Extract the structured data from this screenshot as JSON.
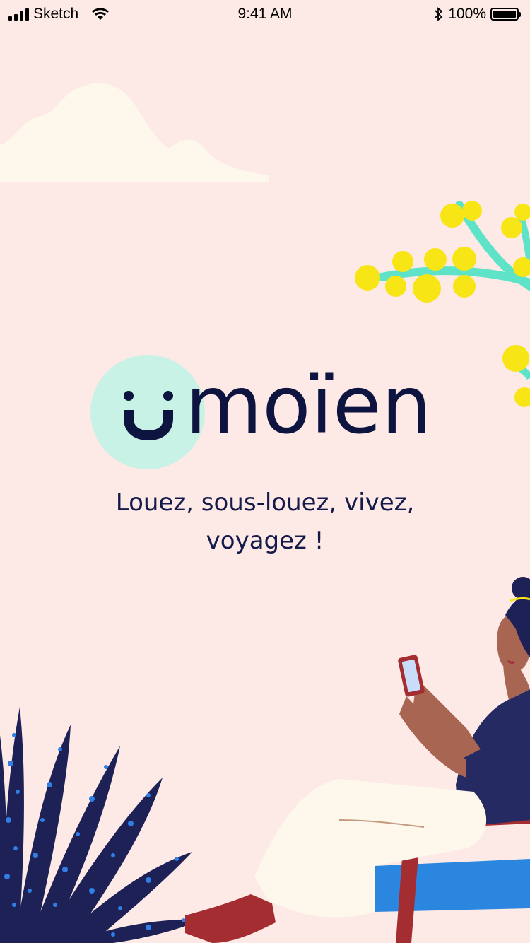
{
  "status_bar": {
    "carrier": "Sketch",
    "time": "9:41 AM",
    "battery": "100%",
    "battery_level": 1.0
  },
  "brand": {
    "name": "moïen",
    "colors": {
      "navy": "#0d1440",
      "mint": "#c8f2e6",
      "background": "#fde9e6"
    }
  },
  "tagline": {
    "line1": "Louez, sous-louez, vivez,",
    "line2": "voyagez !"
  },
  "icons": [
    "signal-icon",
    "wifi-icon",
    "bluetooth-icon",
    "battery-icon"
  ]
}
